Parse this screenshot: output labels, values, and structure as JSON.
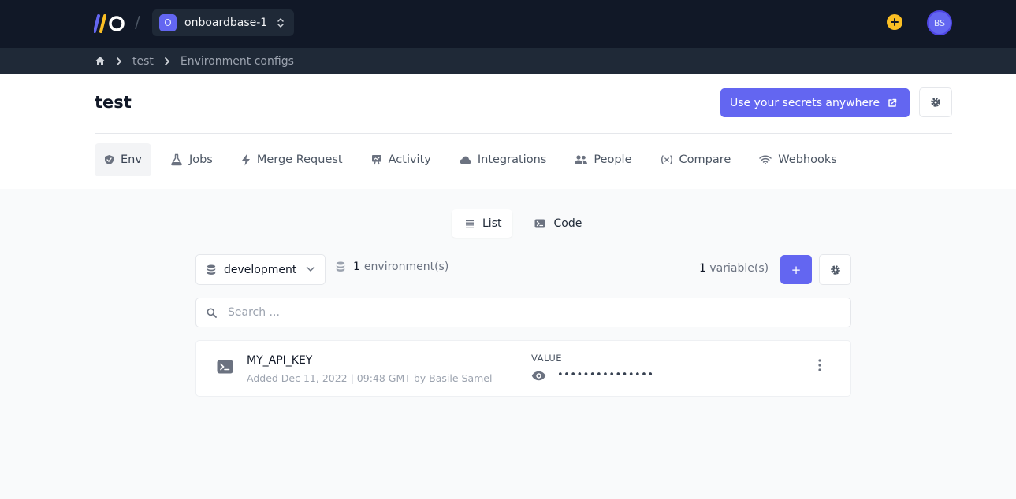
{
  "topbar": {
    "logo": "onboardbase-logo",
    "separator": "/",
    "org": {
      "initial": "O",
      "name": "onboardbase-1"
    },
    "add_icon": "plus-circle-icon",
    "user_initials": "BS"
  },
  "breadcrumb": {
    "home_icon": "home-icon",
    "items": [
      "test",
      "Environment configs"
    ]
  },
  "header": {
    "title": "test",
    "secrets_button": "Use your secrets anywhere",
    "tabs": [
      {
        "label": "Env",
        "icon": "shield-icon",
        "active": true
      },
      {
        "label": "Jobs",
        "icon": "flask-icon"
      },
      {
        "label": "Merge Request",
        "icon": "bolt-icon"
      },
      {
        "label": "Activity",
        "icon": "presentation-icon"
      },
      {
        "label": "Integrations",
        "icon": "cloud-icon"
      },
      {
        "label": "People",
        "icon": "users-icon"
      },
      {
        "label": "Compare",
        "icon": "variable-icon"
      },
      {
        "label": "Webhooks",
        "icon": "wifi-icon"
      }
    ]
  },
  "view_toggle": {
    "list": "List",
    "code": "Code",
    "active": "List"
  },
  "toolbar": {
    "environment": "development",
    "environments_count": "1",
    "environments_label": "environment(s)",
    "variables_count": "1",
    "variables_label": "variable(s)",
    "add_label": "+"
  },
  "search": {
    "placeholder": "Search ..."
  },
  "variables": [
    {
      "key": "MY_API_KEY",
      "meta": "Added Dec 11, 2022 | 09:48 GMT by Basile Samel",
      "value_label": "VALUE",
      "masked_value": "•••••••••••••••"
    }
  ],
  "colors": {
    "topbar": "#111827",
    "breadcrumb_bar": "#1f2937",
    "accent": "#6366f1",
    "add_icon": "#fbbf24"
  }
}
